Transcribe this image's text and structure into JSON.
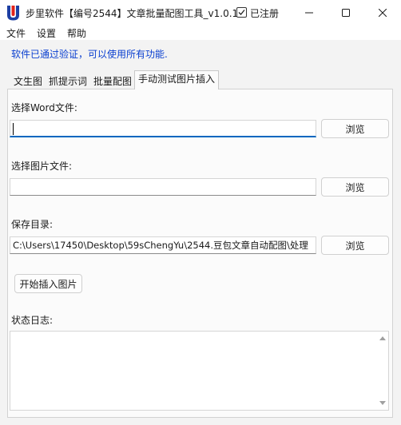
{
  "window": {
    "title": "步里软件【编号2544】文章批量配图工具_v1.0.1 -",
    "registered_label": "已注册",
    "minimize_icon": "minimize-icon",
    "maximize_icon": "maximize-icon",
    "close_icon": "close-icon"
  },
  "menu": {
    "items": [
      "文件",
      "设置",
      "帮助"
    ]
  },
  "verification_message": "软件已通过验证，可以使用所有功能.",
  "tabs": [
    {
      "label": "文生图",
      "active": false
    },
    {
      "label": "抓提示词",
      "active": false
    },
    {
      "label": "批量配图",
      "active": false
    },
    {
      "label": "手动测试图片插入",
      "active": true
    }
  ],
  "panel": {
    "word_file": {
      "label": "选择Word文件:",
      "value": "",
      "browse": "浏览"
    },
    "image_file": {
      "label": "选择图片文件:",
      "value": "",
      "browse": "浏览"
    },
    "save_dir": {
      "label": "保存目录:",
      "value": "C:\\Users\\17450\\Desktop\\59sChengYu\\2544.豆包文章自动配图\\处理",
      "browse": "浏览"
    },
    "start_button": "开始插入图片",
    "log_label": "状态日志:",
    "log_text": ""
  },
  "colors": {
    "accent": "#0067c0",
    "verified_text": "#0a3fd0",
    "icon_red": "#e2231a",
    "icon_blue": "#1d3fa3"
  }
}
